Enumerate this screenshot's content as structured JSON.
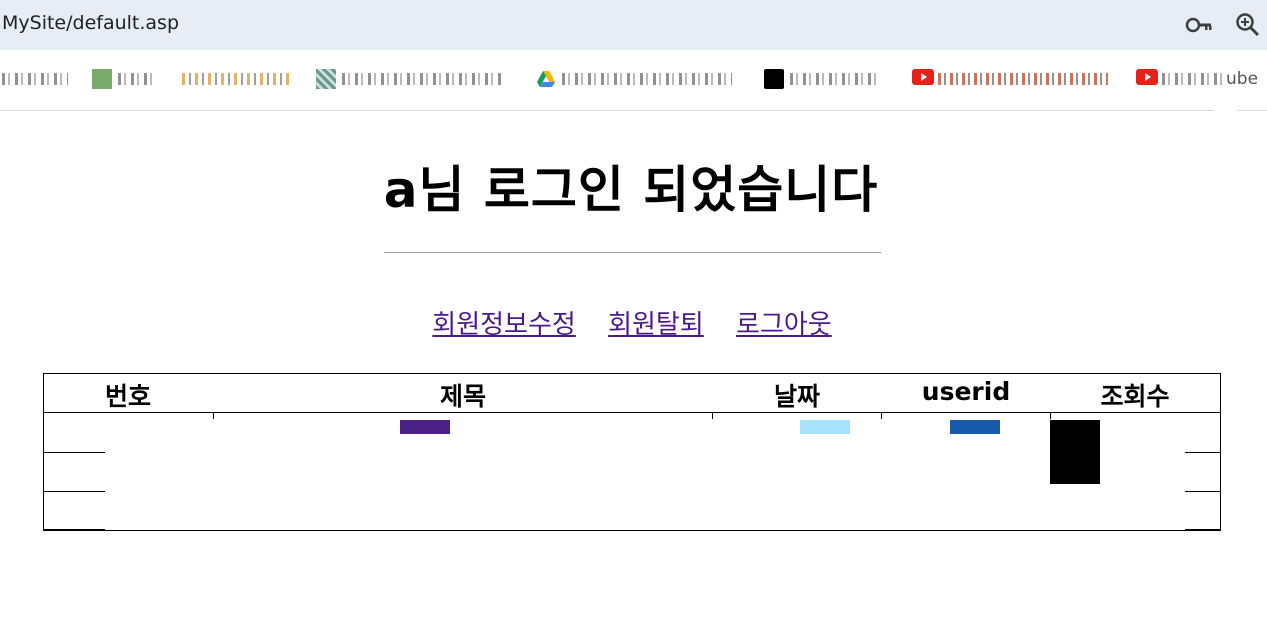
{
  "browser": {
    "url": "MySite/default.asp",
    "key_icon": "key-icon",
    "zoom_icon": "zoom-icon",
    "bookmarks": [
      {
        "icon": "bookmark-favicon",
        "color": "#e8a060"
      },
      {
        "icon": "bookmark-favicon",
        "color": "#5a9a5a"
      },
      {
        "icon": "bookmark-favicon",
        "color": "#d8a040"
      },
      {
        "icon": "bookmark-favicon",
        "color": "#6a9a80"
      },
      {
        "icon": "google-drive-icon",
        "color": "#f4b400"
      },
      {
        "icon": "bookmark-favicon",
        "color": "#000000"
      },
      {
        "icon": "youtube-icon",
        "color": "#e62117"
      },
      {
        "icon": "youtube-icon",
        "color": "#e62117",
        "label": "ube"
      }
    ]
  },
  "page": {
    "title": "a님 로그인 되었습니다",
    "links": {
      "edit_profile": "회원정보수정",
      "withdraw": "회원탈퇴",
      "logout": "로그아웃"
    }
  },
  "board": {
    "columns": [
      "번호",
      "제목",
      "날짜",
      "userid",
      "조회수"
    ],
    "row_count": 3,
    "colors": {
      "title_swatch": "#4b2185",
      "date_swatch": "#a8e2fd",
      "userid_swatch": "#1a5aad",
      "views_block": "#000000"
    }
  }
}
